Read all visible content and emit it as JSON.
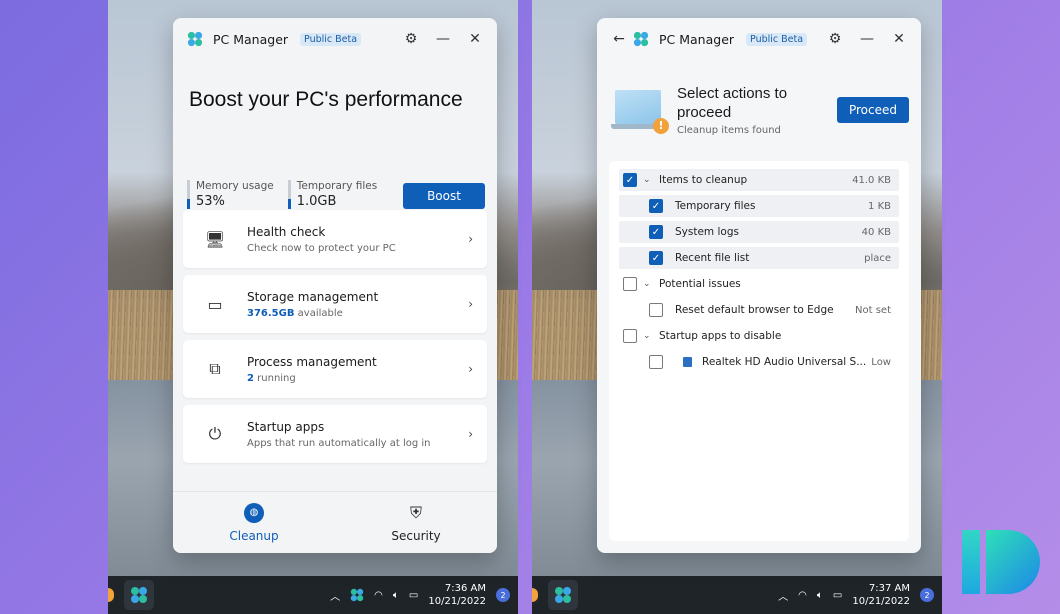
{
  "colors": {
    "accent": "#0f5fb8",
    "beta_bg": "#d9e8f7",
    "warning": "#f2a23a"
  },
  "left_window": {
    "app_title": "PC Manager",
    "badge": "Public Beta",
    "hero_title": "Boost your PC's performance",
    "stats": [
      {
        "label": "Memory usage",
        "value": "53%"
      },
      {
        "label": "Temporary files",
        "value": "1.0GB"
      }
    ],
    "boost_label": "Boost",
    "cards": [
      {
        "title": "Health check",
        "subtitle": "Check now to protect your PC",
        "icon": "monitor-icon"
      },
      {
        "title": "Storage management",
        "highlight": "376.5GB",
        "subtitle": "available",
        "icon": "drive-icon"
      },
      {
        "title": "Process management",
        "highlight": "2",
        "subtitle": "running",
        "icon": "process-icon"
      },
      {
        "title": "Startup apps",
        "subtitle": "Apps that run automatically at log in",
        "icon": "power-icon"
      }
    ],
    "nav": [
      {
        "label": "Cleanup",
        "active": true
      },
      {
        "label": "Security",
        "active": false
      }
    ]
  },
  "right_window": {
    "app_title": "PC Manager",
    "badge": "Public Beta",
    "heading": "Select actions to proceed",
    "subheading": "Cleanup items found",
    "proceed_label": "Proceed",
    "items": [
      {
        "label": "Items to cleanup",
        "value": "41.0 KB",
        "checked": true,
        "group": true
      },
      {
        "label": "Temporary files",
        "value": "1 KB",
        "checked": true
      },
      {
        "label": "System logs",
        "value": "40 KB",
        "checked": true
      },
      {
        "label": "Recent file list",
        "value": "place",
        "checked": true
      },
      {
        "label": "Potential issues",
        "value": "",
        "checked": false,
        "group": true
      },
      {
        "label": "Reset default browser to Edge",
        "value": "Not set",
        "checked": false
      },
      {
        "label": "Startup apps to disable",
        "value": "",
        "checked": false,
        "group": true
      },
      {
        "label": "Realtek HD Audio Universal S...",
        "value": "Low",
        "checked": false
      }
    ]
  },
  "taskbar_left": {
    "time": "7:36 AM",
    "date": "10/21/2022",
    "badge": "2"
  },
  "taskbar_right": {
    "time": "7:37 AM",
    "date": "10/21/2022",
    "badge": "2"
  }
}
